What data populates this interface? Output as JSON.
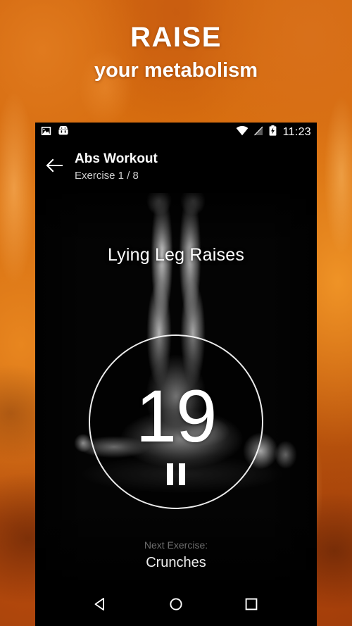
{
  "promo": {
    "headline_main": "RAISE",
    "headline_sub": "your metabolism",
    "background_color": "#d2670f",
    "text_color": "#ffffff"
  },
  "statusbar": {
    "icons_left": [
      "image-icon",
      "android-head-icon"
    ],
    "icons_right": [
      "wifi-icon",
      "signal-no-sim-icon",
      "battery-charging-icon"
    ],
    "time": "11:23"
  },
  "appbar": {
    "back_icon": "arrow-left-icon",
    "title": "Abs Workout",
    "subtitle": "Exercise 1 / 8"
  },
  "workout": {
    "exercise_name": "Lying Leg Raises",
    "timer_seconds": "19",
    "pause_icon": "pause-icon",
    "next_label": "Next Exercise:",
    "next_exercise": "Crunches",
    "next_label_color": "#6d6d6d",
    "circle_stroke_color": "#ffffff"
  },
  "navbar": {
    "back_icon": "triangle-back-icon",
    "home_icon": "circle-home-icon",
    "recents_icon": "square-recents-icon"
  }
}
